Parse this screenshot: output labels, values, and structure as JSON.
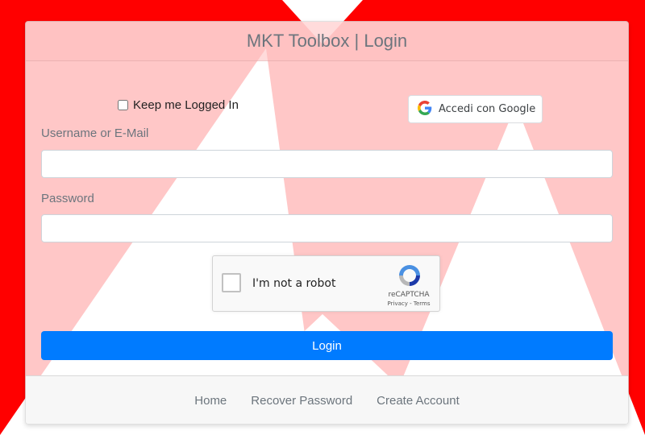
{
  "header": {
    "title": "MKT Toolbox | Login"
  },
  "form": {
    "keep_logged_in_label": "Keep me Logged In",
    "keep_logged_in_checked": false,
    "google_button_label": "Accedi con Google",
    "username_label": "Username or E-Mail",
    "username_value": "",
    "password_label": "Password",
    "password_value": "",
    "login_button_label": "Login"
  },
  "recaptcha": {
    "checkbox_label": "I'm not a robot",
    "brand": "reCAPTCHA",
    "terms": "Privacy - Terms"
  },
  "footer": {
    "links": [
      "Home",
      "Recover Password",
      "Create Account"
    ]
  },
  "colors": {
    "background": "#ff0000",
    "primary_button": "#007bff",
    "header_text": "#6c757d"
  }
}
